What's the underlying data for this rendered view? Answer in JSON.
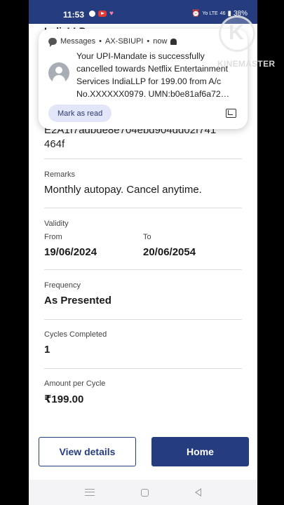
{
  "status_bar": {
    "time": "11:53",
    "network_label": "Yo LTE",
    "signal_text": "46",
    "battery": "38%"
  },
  "header": {
    "partial_title": "IndiaLLP"
  },
  "notification": {
    "app": "Messages",
    "sender": "AX-SBIUPI",
    "when": "now",
    "body": "Your UPI-Mandate is successfully cancelled towards Netflix Entertainment Services IndiaLLP for 199.00 from A/c No.XXXXXX0979. UMN:b0e81af6a72…",
    "mark_as_read": "Mark as read"
  },
  "umn_fragment": {
    "line1": "E2A1I7adbde8e704ebd904dd02f741",
    "line2": "464f"
  },
  "details": {
    "remarks_label": "Remarks",
    "remarks_value": "Monthly autopay. Cancel anytime.",
    "validity_label": "Validity",
    "from_label": "From",
    "from_value": "19/06/2024",
    "to_label": "To",
    "to_value": "20/06/2054",
    "frequency_label": "Frequency",
    "frequency_value": "As Presented",
    "cycles_label": "Cycles Completed",
    "cycles_value": "1",
    "amount_label": "Amount per Cycle",
    "amount_value": "₹199.00"
  },
  "buttons": {
    "view_details": "View details",
    "home": "Home"
  },
  "watermark": {
    "logo_letter": "K",
    "text": "KINEMASTER"
  },
  "colors": {
    "brand": "#253d7f",
    "chip": "#e2e6f8"
  },
  "icons": [
    "message-icon",
    "bell-icon",
    "avatar-icon",
    "expand-icon",
    "menu-icon",
    "home-icon",
    "back-icon"
  ]
}
